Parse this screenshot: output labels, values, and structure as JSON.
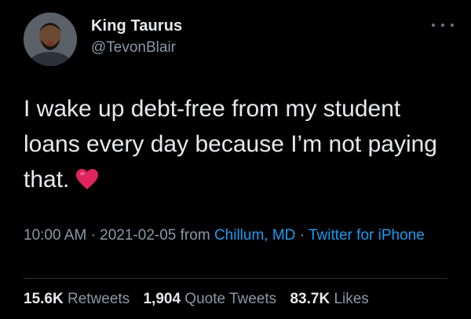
{
  "author": {
    "name": "King Taurus",
    "handle": "@TevonBlair"
  },
  "tweet": {
    "text": "I wake up debt-free from my student loans every day because I’m not paying that.",
    "emoji": "heart-emoji"
  },
  "meta": {
    "time": "10:00 AM",
    "date": "2021-02-05",
    "from_label": "from",
    "location": "Chillum, MD",
    "source": "Twitter for iPhone",
    "separator": "·"
  },
  "stats": {
    "retweets_count": "15.6K",
    "retweets_label": "Retweets",
    "quotes_count": "1,904",
    "quotes_label": "Quote Tweets",
    "likes_count": "83.7K",
    "likes_label": "Likes"
  },
  "colors": {
    "background": "#000000",
    "text": "#e7e9ea",
    "muted": "#8b98a5",
    "link": "#1d9bf0",
    "heart": "#e0245e"
  }
}
